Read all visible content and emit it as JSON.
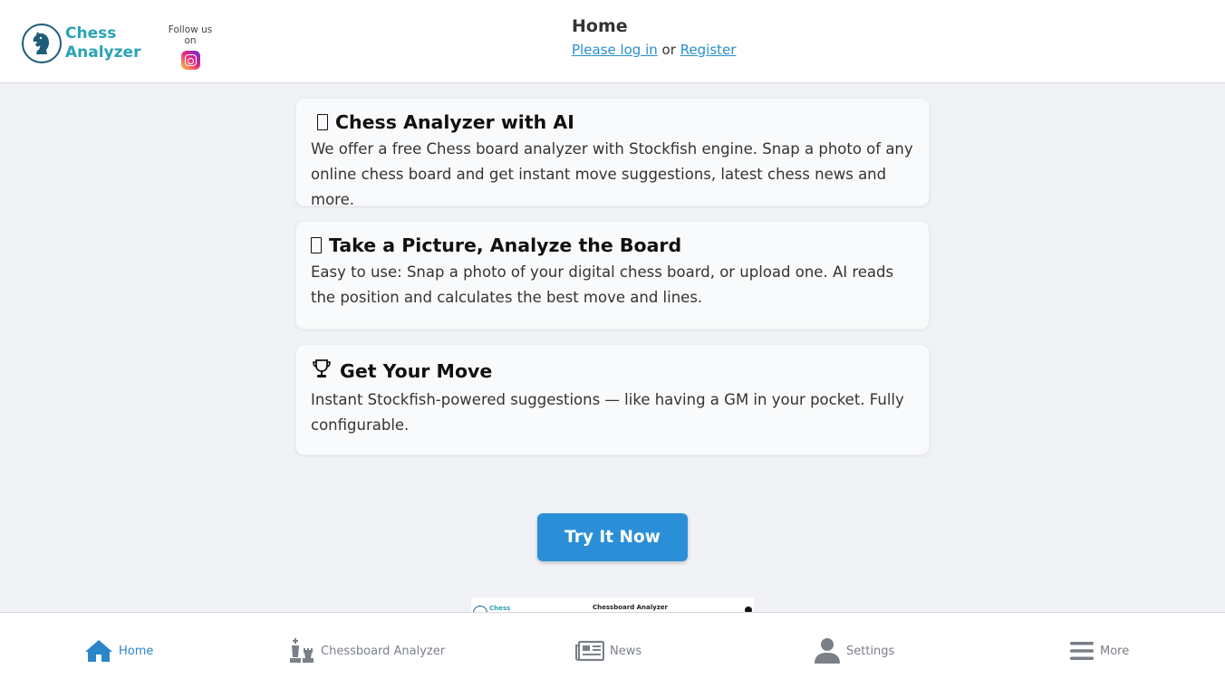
{
  "header": {
    "brand_line1": "Chess",
    "brand_line2": "Analyzer",
    "follow_label": "Follow us on",
    "title": "Home",
    "login_link": "Please log in",
    "or_text": "or",
    "register_link": "Register"
  },
  "cards": [
    {
      "title": "Chess Analyzer with AI",
      "body": "We offer a free Chess board analyzer with Stockfish engine. Snap a photo of any online chess board and get instant move suggestions, latest chess news and more."
    },
    {
      "title": "Take a Picture, Analyze the Board",
      "body": "Easy to use: Snap a photo of your digital chess board, or upload one. AI reads the position and calculates the best move and lines."
    },
    {
      "title": "Get Your Move",
      "body": "Instant Stockfish-powered suggestions — like having a GM in your pocket. Fully configurable."
    }
  ],
  "cta_label": "Try It Now",
  "preview": {
    "brand": "Chess",
    "title": "Chessboard Analyzer"
  },
  "bottom_nav": [
    {
      "label": "Home",
      "icon": "home-icon",
      "active": true
    },
    {
      "label": "Chessboard Analyzer",
      "icon": "chess-pieces-icon",
      "active": false
    },
    {
      "label": "News",
      "icon": "newspaper-icon",
      "active": false
    },
    {
      "label": "Settings",
      "icon": "user-icon",
      "active": false
    },
    {
      "label": "More",
      "icon": "menu-icon",
      "active": false
    }
  ],
  "colors": {
    "accent": "#2b8fd8",
    "brand_teal": "#2aa3b5",
    "nav_active": "#2a86c9",
    "nav_inactive": "#7b8087"
  }
}
